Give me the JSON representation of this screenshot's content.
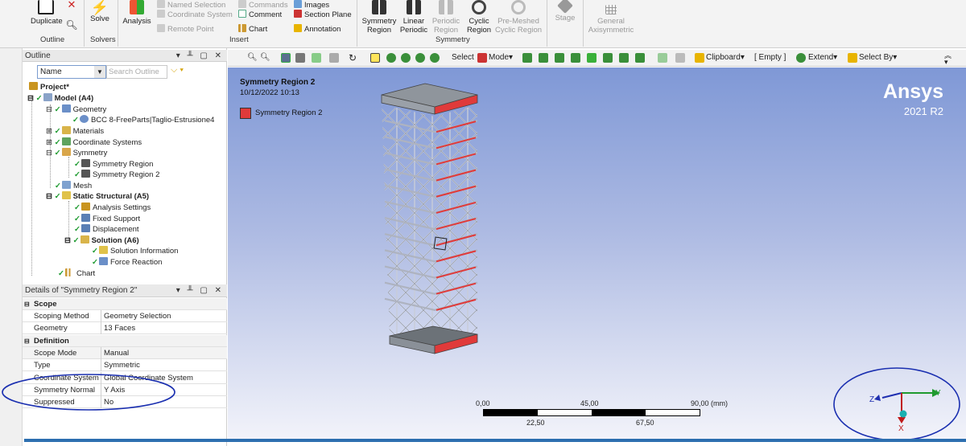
{
  "ribbon": {
    "duplicate": "Duplicate",
    "outline_group": "Outline",
    "solve": "Solve",
    "solvers_group": "Solvers",
    "analysis": "Analysis",
    "named_selection": "Named Selection",
    "coordinate_system": "Coordinate System",
    "remote_point": "Remote Point",
    "commands": "Commands",
    "comment": "Comment",
    "chart": "Chart",
    "images": "Images",
    "section_plane": "Section Plane",
    "annotation": "Annotation",
    "insert_group": "Insert",
    "symmetry_region": [
      "Symmetry",
      "Region"
    ],
    "linear_periodic": [
      "Linear",
      "Periodic"
    ],
    "periodic_region": [
      "Periodic",
      "Region"
    ],
    "cyclic_region": [
      "Cyclic",
      "Region"
    ],
    "pre_meshed": [
      "Pre-Meshed",
      "Cyclic Region"
    ],
    "symmetry_group": "Symmetry",
    "stage": "Stage",
    "general_axisymmetric": [
      "General",
      "Axisymmetric"
    ]
  },
  "outline": {
    "title": "Outline",
    "filter_value": "Name",
    "search_placeholder": "Search Outline",
    "tree": [
      {
        "label": "Project*",
        "bold": true
      },
      {
        "label": "Model (A4)",
        "bold": true
      },
      {
        "label": "Geometry"
      },
      {
        "label": "BCC 8-FreeParts|Taglio-Estrusione4"
      },
      {
        "label": "Materials"
      },
      {
        "label": "Coordinate Systems"
      },
      {
        "label": "Symmetry"
      },
      {
        "label": "Symmetry Region"
      },
      {
        "label": "Symmetry Region 2"
      },
      {
        "label": "Mesh"
      },
      {
        "label": "Static Structural (A5)",
        "bold": true
      },
      {
        "label": "Analysis Settings"
      },
      {
        "label": "Fixed Support"
      },
      {
        "label": "Displacement"
      },
      {
        "label": "Solution (A6)",
        "bold": true
      },
      {
        "label": "Solution Information"
      },
      {
        "label": "Force Reaction"
      },
      {
        "label": "Chart"
      }
    ]
  },
  "details": {
    "title": "Details of \"Symmetry Region 2\"",
    "rows": [
      {
        "k": "Scope",
        "section": true
      },
      {
        "k": "Scoping Method",
        "v": "Geometry Selection"
      },
      {
        "k": "Geometry",
        "v": "13 Faces"
      },
      {
        "k": "Definition",
        "section": true
      },
      {
        "k": "Scope Mode",
        "v": "Manual"
      },
      {
        "k": "Type",
        "v": "Symmetric"
      },
      {
        "k": "Coordinate System",
        "v": "Global Coordinate System"
      },
      {
        "k": "Symmetry Normal",
        "v": "Y Axis"
      },
      {
        "k": "Suppressed",
        "v": "No"
      }
    ]
  },
  "graphics_toolbar": {
    "select": "Select",
    "mode": "Mode",
    "clipboard": "Clipboard",
    "empty": "[ Empty ]",
    "extend": "Extend",
    "select_by": "Select By"
  },
  "viewport": {
    "title": "Symmetry Region 2",
    "timestamp": "10/12/2022 10:13",
    "legend_label": "Symmetry Region 2",
    "legend_color": "#e03a3a",
    "brand": "Ansys",
    "version": "2021 R2",
    "scale_top": [
      "0,00",
      "45,00",
      "90,00 (mm)"
    ],
    "scale_bottom": [
      "22,50",
      "67,50"
    ],
    "axes": {
      "x": "X",
      "y": "Y",
      "z": "Z"
    }
  },
  "colors": {
    "accent": "#2d6fb0",
    "highlight": "#e03a3a",
    "annotation_circle": "#1a2fb0"
  }
}
